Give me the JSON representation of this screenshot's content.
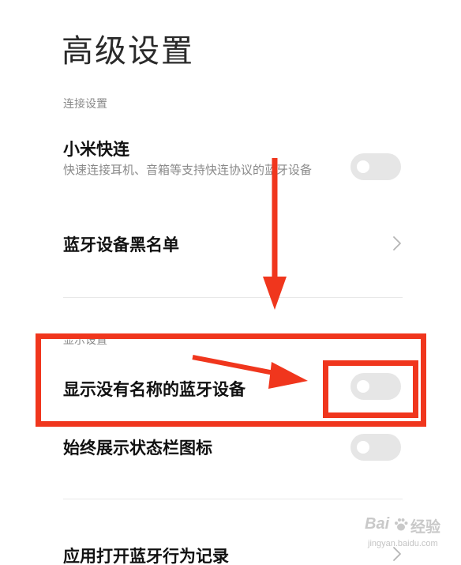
{
  "page": {
    "title": "高级设置"
  },
  "sections": {
    "connection": {
      "label": "连接设置",
      "xiaomi_fast_connect": {
        "title": "小米快连",
        "description": "快速连接耳机、音箱等支持快连协议的蓝牙设备",
        "enabled": false
      },
      "bluetooth_blacklist": {
        "title": "蓝牙设备黑名单"
      }
    },
    "display": {
      "label": "显示设置",
      "show_unnamed_devices": {
        "title": "显示没有名称的蓝牙设备",
        "enabled": false
      },
      "always_show_status_icon": {
        "title": "始终展示状态栏图标",
        "enabled": false
      },
      "app_bluetooth_log": {
        "title": "应用打开蓝牙行为记录"
      }
    }
  },
  "colors": {
    "annotation": "#f0361d",
    "toggle_off": "#e6e6e6",
    "secondary_text": "#8a8a8a"
  },
  "icons": {
    "chevron": "chevron-right-icon",
    "watermark": "baidu-paw-icon"
  },
  "watermark": {
    "brand": "Bai",
    "brand_cn": "经验",
    "domain": "jingyan.baidu.com"
  }
}
